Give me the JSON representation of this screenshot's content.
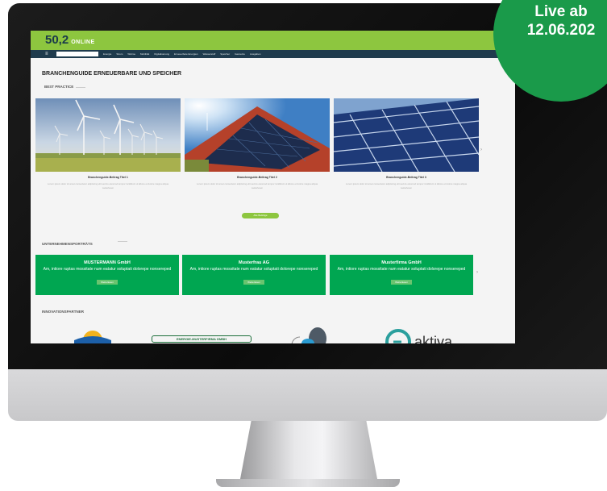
{
  "badge": {
    "line1": "Live ab",
    "line2": "12.06.202"
  },
  "site": {
    "logo_number": "50,2",
    "logo_word": "ONLINE",
    "page_title": "BRANCHENGUIDE ERNEUERBARE UND SPEICHER",
    "section_best_practice": "BEST PRACTICE",
    "section_companies": "UNTERNEHMENSPORTRÄTS",
    "section_sponsors": "INNOVATIONSPARTNER",
    "cards": [
      {
        "caption": "Branchenguide-Beitrag Titel 1",
        "text": "Lorem ipsum dolor sit amet consectetur adipiscing elit sed do eiusmod tempor incididunt ut labore et dolore magna aliqua",
        "link": "weiterlesen"
      },
      {
        "caption": "Branchenguide-Beitrag Titel 2",
        "text": "Lorem ipsum dolor sit amet consectetur adipiscing elit sed do eiusmod tempor incididunt ut labore et dolore magna aliqua",
        "link": "weiterlesen"
      },
      {
        "caption": "Branchenguide-Beitrag Titel 3",
        "text": "Lorem ipsum dolor sit amet consectetur adipiscing elit sed do eiusmod tempor incididunt ut labore et dolore magna aliqua",
        "link": "weiterlesen"
      }
    ],
    "more_button": "Alle Beiträge",
    "companies": [
      {
        "name": "MUSTERMANN GmbH",
        "desc": "Am, intiore ruptas mossitate num eatatur soluptati dolorepe nonsereped",
        "button": "Weiterlesen"
      },
      {
        "name": "Musterfrau AG",
        "desc": "Am, intiore ruptas mossitate num eatatur soluptati dolorepe nonsereped",
        "button": "Weiterlesen"
      },
      {
        "name": "Musterfirma GmbH",
        "desc": "Am, intiore ruptas mossitate num eatatur soluptati dolorepe nonsereped",
        "button": "Weiterlesen"
      }
    ],
    "sponsor2_text": "ENERGIE-MUSTERFIRMA GMBH",
    "sponsor4_text": "aktiva",
    "nav": [
      "Energie",
      "Strom",
      "Wärme",
      "Mobilität",
      "Digitalisierung",
      "Erneuerbare Energien",
      "Wasserstoff",
      "Speicher",
      "Gasnetze",
      "Ausgaben"
    ],
    "search_placeholder": ""
  },
  "colors": {
    "brand_green": "#8dc63f",
    "card_green": "#00a651",
    "badge_green": "#1a9a4a",
    "nav_dark": "#1f3b4d"
  }
}
